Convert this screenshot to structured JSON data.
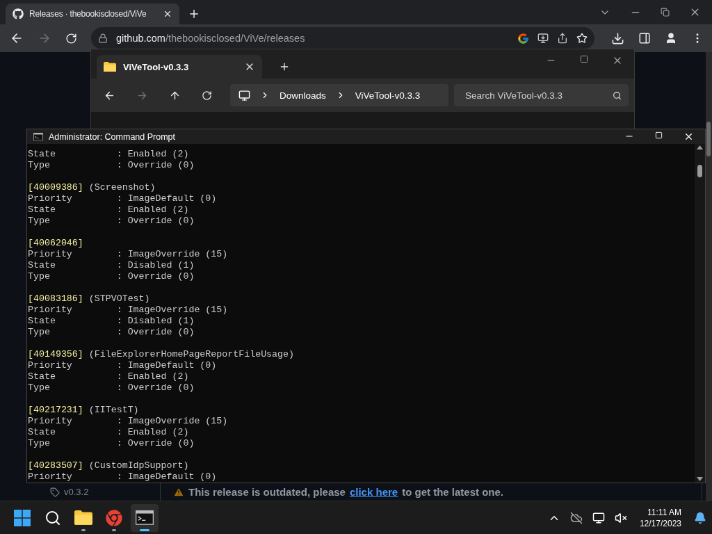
{
  "browser": {
    "tabs": [
      {
        "title": "Releases · thebookisclosed/ViVe",
        "selected": true
      }
    ],
    "nav": {
      "back_disabled": false,
      "forward_disabled": true
    },
    "url": {
      "host": "github.com",
      "path": "/thebookisclosed/ViVe/releases"
    }
  },
  "explorer": {
    "tabs": [
      {
        "title": "ViVeTool-v0.3.3",
        "selected": true
      }
    ],
    "nav": {
      "forward_disabled": true
    },
    "breadcrumb": [
      "Downloads",
      "ViVeTool-v0.3.3"
    ],
    "search": {
      "placeholder": "Search ViVeTool-v0.3.3"
    }
  },
  "cmd": {
    "title": "Administrator: Command Prompt",
    "lines": [
      {
        "kind": "field",
        "text": "State           : Enabled (2)"
      },
      {
        "kind": "field",
        "text": "Type            : Override (0)"
      },
      {
        "kind": "blank"
      },
      {
        "kind": "header",
        "id": "[40009386]",
        "name": "(Screenshot)"
      },
      {
        "kind": "field",
        "text": "Priority        : ImageDefault (0)"
      },
      {
        "kind": "field",
        "text": "State           : Enabled (2)"
      },
      {
        "kind": "field",
        "text": "Type            : Override (0)"
      },
      {
        "kind": "blank"
      },
      {
        "kind": "header",
        "id": "[40062046]"
      },
      {
        "kind": "field",
        "text": "Priority        : ImageOverride (15)"
      },
      {
        "kind": "field",
        "text": "State           : Disabled (1)"
      },
      {
        "kind": "field",
        "text": "Type            : Override (0)"
      },
      {
        "kind": "blank"
      },
      {
        "kind": "header",
        "id": "[40083186]",
        "name": "(STPVOTest)"
      },
      {
        "kind": "field",
        "text": "Priority        : ImageOverride (15)"
      },
      {
        "kind": "field",
        "text": "State           : Disabled (1)"
      },
      {
        "kind": "field",
        "text": "Type            : Override (0)"
      },
      {
        "kind": "blank"
      },
      {
        "kind": "header",
        "id": "[40149356]",
        "name": "(FileExplorerHomePageReportFileUsage)"
      },
      {
        "kind": "field",
        "text": "Priority        : ImageDefault (0)"
      },
      {
        "kind": "field",
        "text": "State           : Enabled (2)"
      },
      {
        "kind": "field",
        "text": "Type            : Override (0)"
      },
      {
        "kind": "blank"
      },
      {
        "kind": "header",
        "id": "[40217231]",
        "name": "(IITestT)"
      },
      {
        "kind": "field",
        "text": "Priority        : ImageOverride (15)"
      },
      {
        "kind": "field",
        "text": "State           : Enabled (2)"
      },
      {
        "kind": "field",
        "text": "Type            : Override (0)"
      },
      {
        "kind": "blank"
      },
      {
        "kind": "header",
        "id": "[40283507]",
        "name": "(CustomIdpSupport)"
      },
      {
        "kind": "field",
        "text": "Priority        : ImageDefault (0)"
      }
    ]
  },
  "github": {
    "tag": "v0.3.2",
    "banner_before": "This release is outdated, please",
    "banner_link": "click here",
    "banner_after": "to get the latest one."
  },
  "taskbar": {
    "apps": [
      {
        "kind": "explorer",
        "running": true,
        "active": false
      },
      {
        "kind": "chrome",
        "running": true,
        "active": false
      },
      {
        "kind": "terminal",
        "running": true,
        "active": true
      }
    ],
    "time": "11:11 AM",
    "date": "12/17/2023"
  }
}
